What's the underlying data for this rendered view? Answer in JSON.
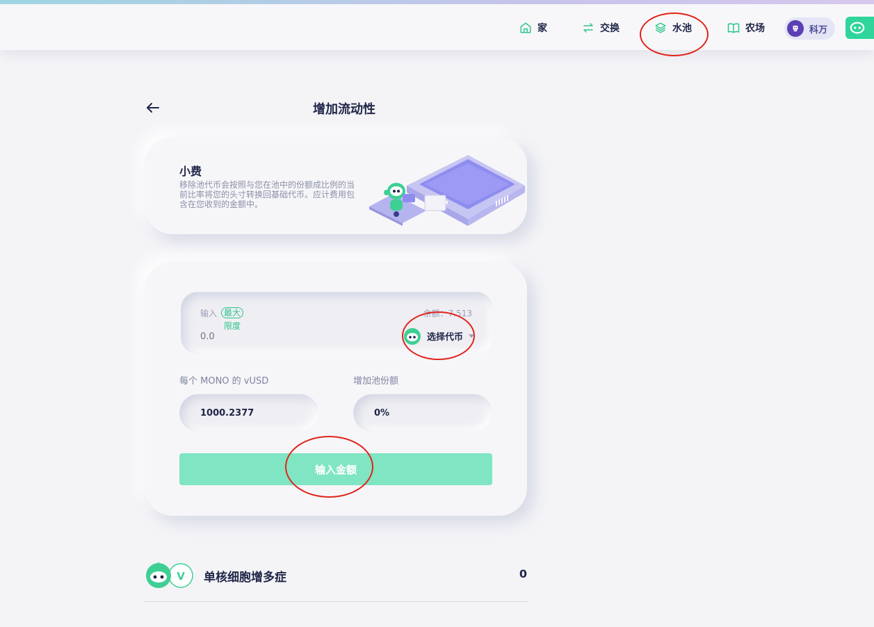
{
  "nav": {
    "items": [
      {
        "label": "家",
        "icon": "home-icon"
      },
      {
        "label": "交换",
        "icon": "swap-icon"
      },
      {
        "label": "水池",
        "icon": "layers-icon"
      },
      {
        "label": "农场",
        "icon": "book-icon"
      }
    ],
    "user": {
      "label": "科万",
      "icon": "user-avatar-icon"
    },
    "wallet": {
      "icon": "mono-logo-icon"
    }
  },
  "page": {
    "title": "增加流动性",
    "back_icon": "back-arrow-icon"
  },
  "info": {
    "title": "小费",
    "text": "移除池代币会按照与您在池中的份额成比例的当前比率将您的头寸转换回基础代币。应计费用包含在您收到的金额中。"
  },
  "input": {
    "label": "输入",
    "max_label": "最大",
    "max_sub": "限度",
    "placeholder": "0.0",
    "balance": "余额：7.513",
    "token_select_label": "选择代币"
  },
  "stats": {
    "price_label": "每个 MONO 的 vUSD",
    "price_value": "1000.2377",
    "share_label": "增加池份额",
    "share_value": "0%"
  },
  "submit": {
    "label": "输入金额"
  },
  "pair": {
    "name": "单核细胞增多症",
    "value": "0"
  },
  "colors": {
    "accent": "#2fd59a",
    "button_disabled": "#80e5c2",
    "annotation_red": "#e0231a",
    "text_dark": "#1f2547"
  }
}
